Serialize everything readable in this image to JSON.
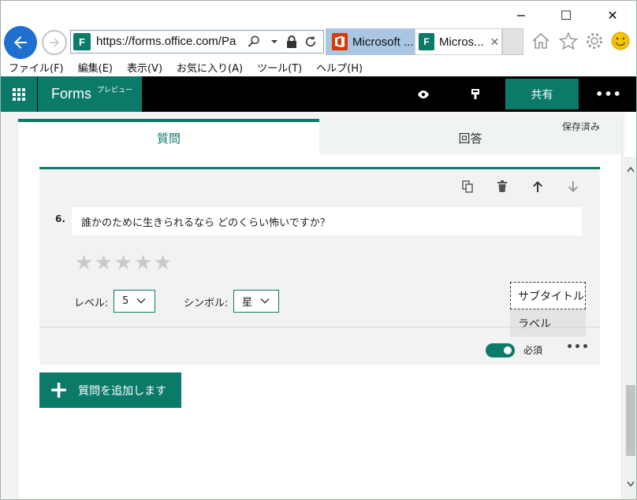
{
  "browser": {
    "window_controls": {
      "minimize": "−",
      "maximize": "☐",
      "close": "✕"
    },
    "address": {
      "url": "https://forms.office.com/Pa",
      "favicon_letter": "F"
    },
    "tabs": [
      {
        "title": "Microsoft ...",
        "icon": "office-icon",
        "icon_color": "#d83b01"
      },
      {
        "title": "Micros...",
        "icon": "forms-icon",
        "icon_color": "#0b7a69",
        "close": "✕"
      }
    ],
    "toolbar_icons": [
      "home-icon",
      "favorites-star-icon",
      "gear-icon",
      "smiley-icon"
    ]
  },
  "menubar": {
    "items": [
      "ファイル(F)",
      "編集(E)",
      "表示(V)",
      "お気に入り(A)",
      "ツール(T)",
      "ヘルプ(H)"
    ]
  },
  "forms_header": {
    "brand": "Forms",
    "preview_tag": "プレビュー",
    "share_label": "共有",
    "more_label": "•••",
    "accent_color": "#0b7a69"
  },
  "tabs": {
    "questions": "質問",
    "answers": "回答",
    "saved_status": "保存済み"
  },
  "question": {
    "number": "6.",
    "title": "誰かのために生きられるなら どのくらい怖いですか？",
    "rating_stars": 5,
    "star_glyph": "★",
    "level_label": "レベル:",
    "level_value": "5",
    "symbol_label": "シンボル:",
    "symbol_value": "星",
    "context_menu": {
      "subtitle": "サブタイトル",
      "label": "ラベル"
    },
    "required_label": "必須",
    "required_on": true,
    "more_label": "•••"
  },
  "add_question": {
    "plus": "+",
    "label": "質問を追加します"
  }
}
